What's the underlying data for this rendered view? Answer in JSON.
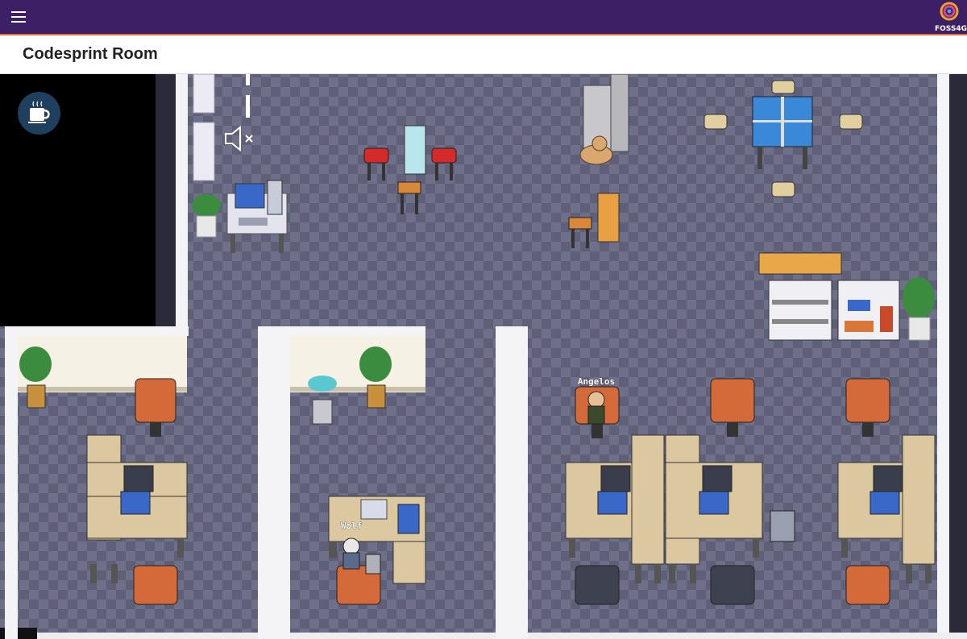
{
  "header": {
    "menu_icon": "hamburger-menu-icon",
    "logo_text": "FOSS4G",
    "bg_color": "#3c1f64",
    "accent_color": "#e0703c"
  },
  "room": {
    "title": "Codesprint Room"
  },
  "controls": {
    "coffee_icon": "coffee-cup-icon",
    "audio_icon": "speaker-muted-icon"
  },
  "players": [
    {
      "name": "Angelos"
    },
    {
      "name": "Wolf"
    }
  ]
}
